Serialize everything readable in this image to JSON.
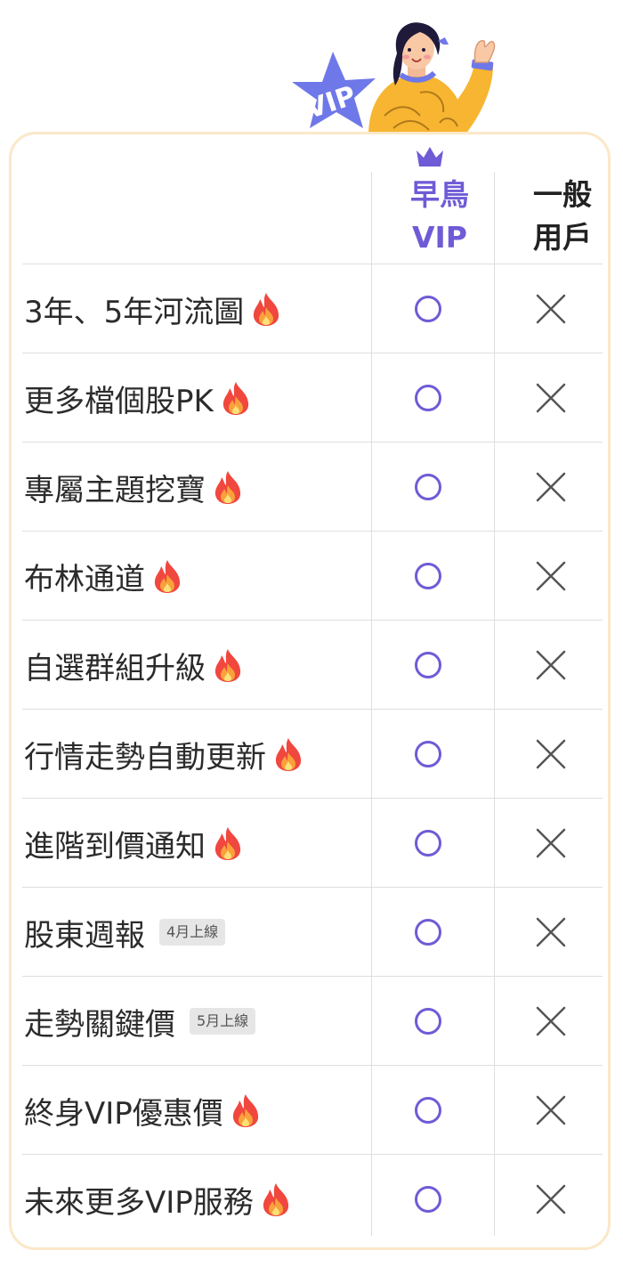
{
  "mascot": {
    "badge_text": "VIP"
  },
  "header": {
    "vip_label_line1": "早鳥",
    "vip_label_line2": "VIP",
    "normal_label_line1": "一般",
    "normal_label_line2": "用戶"
  },
  "colors": {
    "accent": "#6f5bd6",
    "card_border": "#fbe8c9",
    "no_mark": "#555555",
    "badge_bg": "#e6e6e6"
  },
  "rows": [
    {
      "feature": "3年、5年河流圖",
      "icon": "fire-icon",
      "badge": "",
      "vip": "circle",
      "normal": "cross"
    },
    {
      "feature": "更多檔個股PK",
      "icon": "fire-icon",
      "badge": "",
      "vip": "circle",
      "normal": "cross"
    },
    {
      "feature": "專屬主題挖寶",
      "icon": "fire-icon",
      "badge": "",
      "vip": "circle",
      "normal": "cross"
    },
    {
      "feature": "布林通道",
      "icon": "fire-icon",
      "badge": "",
      "vip": "circle",
      "normal": "cross"
    },
    {
      "feature": "自選群組升級",
      "icon": "fire-icon",
      "badge": "",
      "vip": "circle",
      "normal": "cross"
    },
    {
      "feature": "行情走勢自動更新",
      "icon": "fire-icon",
      "badge": "",
      "vip": "circle",
      "normal": "cross"
    },
    {
      "feature": "進階到價通知",
      "icon": "fire-icon",
      "badge": "",
      "vip": "circle",
      "normal": "cross"
    },
    {
      "feature": "股東週報",
      "icon": "",
      "badge": "4月上線",
      "vip": "circle",
      "normal": "cross"
    },
    {
      "feature": "走勢關鍵價",
      "icon": "",
      "badge": "5月上線",
      "vip": "circle",
      "normal": "cross"
    },
    {
      "feature": "終身VIP優惠價",
      "icon": "fire-icon",
      "badge": "",
      "vip": "circle",
      "normal": "cross"
    },
    {
      "feature": "未來更多VIP服務",
      "icon": "fire-icon",
      "badge": "",
      "vip": "circle",
      "normal": "cross"
    }
  ]
}
